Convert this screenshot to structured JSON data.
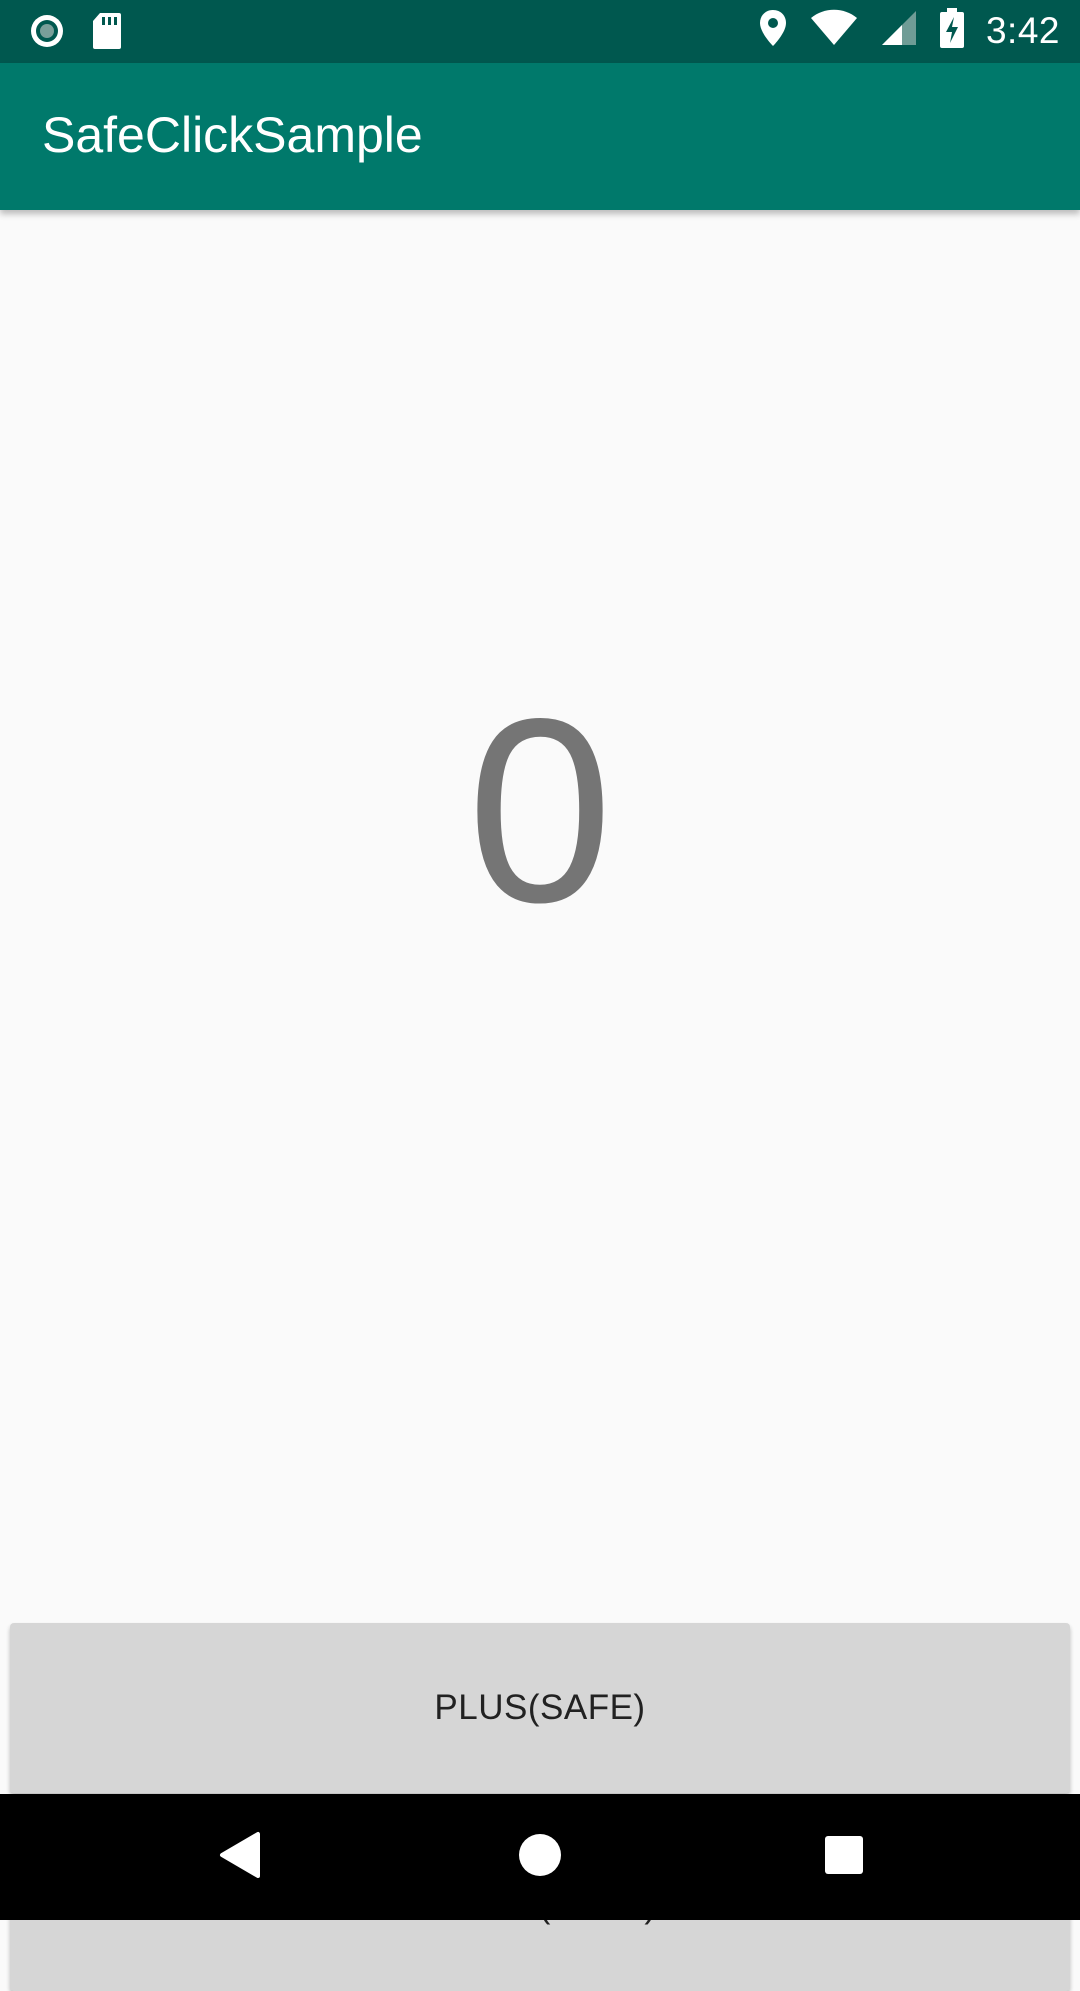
{
  "status_bar": {
    "time": "3:42",
    "icons": [
      "record-icon",
      "sd-card-icon",
      "location-icon",
      "wifi-icon",
      "signal-icon",
      "battery-charging-icon"
    ]
  },
  "app_bar": {
    "title": "SafeClickSample",
    "color": "#00796b"
  },
  "main": {
    "counter_value": "0"
  },
  "buttons": {
    "plus_label": "PLUS(SAFE)",
    "minus_label": "MINUS(SAFE)"
  },
  "nav_bar": {
    "icons": [
      "back-icon",
      "home-icon",
      "recents-icon"
    ]
  }
}
